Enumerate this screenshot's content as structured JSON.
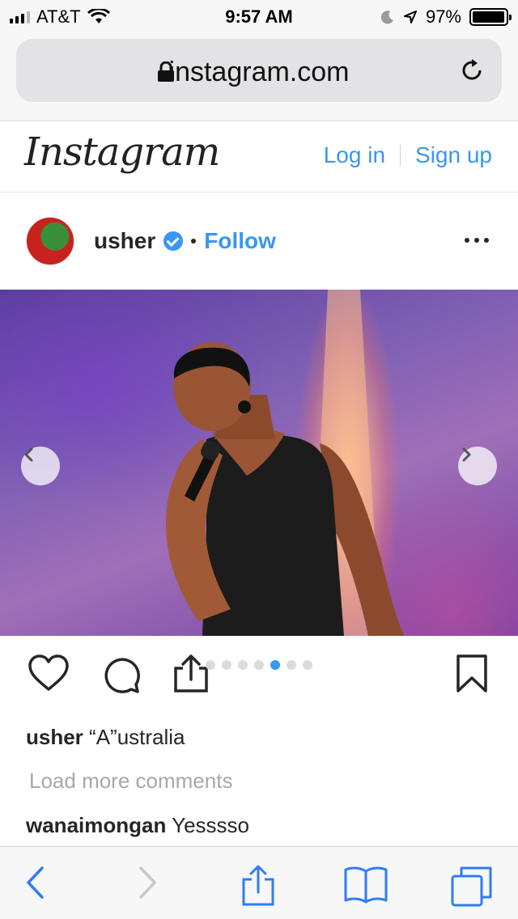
{
  "status_bar": {
    "carrier": "AT&T",
    "time": "9:57 AM",
    "battery": "97%",
    "battery_level": 0.97
  },
  "browser": {
    "url": "instagram.com",
    "lock_icon": "lock-icon",
    "reload_icon": "reload-icon"
  },
  "ig_header": {
    "logo_text": "Instagram",
    "login_label": "Log in",
    "signup_label": "Sign up"
  },
  "post": {
    "username": "usher",
    "verified": true,
    "follow_label": "Follow",
    "carousel_dots": 7,
    "active_dot": 5
  },
  "caption": {
    "username": "usher",
    "text": "“A”ustralia"
  },
  "load_more": "Load more comments",
  "comments": [
    {
      "username": "wanaimongan",
      "text": "Yesssso"
    }
  ],
  "colors": {
    "accent": "#3897f0",
    "text": "#262626",
    "muted": "#a8a8a8",
    "ios_blue": "#2f7cf6"
  }
}
